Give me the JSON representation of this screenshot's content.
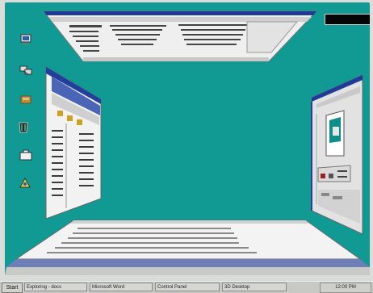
{
  "desktop": {
    "background": "#109a93",
    "icons": [
      {
        "name": "my-computer-icon"
      },
      {
        "name": "network-neighborhood-icon"
      },
      {
        "name": "inbox-icon"
      },
      {
        "name": "recycle-bin-icon"
      },
      {
        "name": "briefcase-icon"
      },
      {
        "name": "msn-icon"
      }
    ]
  },
  "taskbar": {
    "start_label": "Start",
    "tasks": [
      "Exploring - docs",
      "Microsoft Word",
      "Control Panel",
      "3D Desktop"
    ],
    "tray_time": "12:00 PM"
  }
}
